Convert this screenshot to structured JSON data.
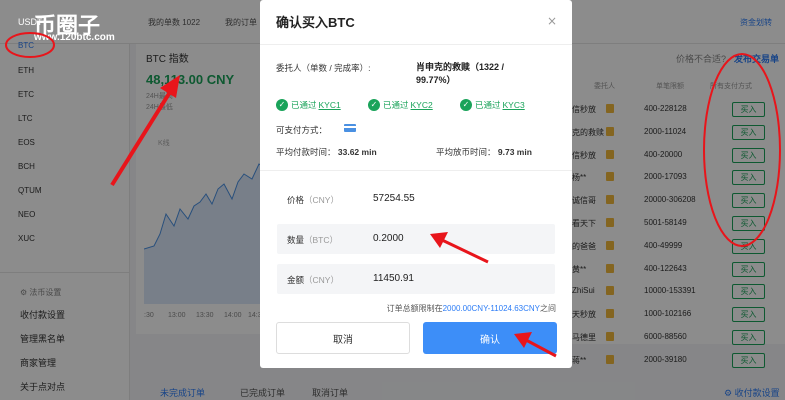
{
  "header": {
    "logo": "币圈子",
    "url": "www.120btc.com",
    "usdt": "USDT",
    "my_orders_label": "我的单数",
    "my_orders_count": "1022",
    "my_orders2": "我的订单",
    "funds_transfer": "资金划转"
  },
  "sidebar": {
    "coins": [
      "BTC",
      "ETH",
      "ETC",
      "LTC",
      "EOS",
      "BCH",
      "QTUM",
      "NEO",
      "XUC"
    ],
    "section": "法币设置",
    "items": [
      "收付款设置",
      "管理黑名单",
      "商家管理",
      "关于点对点"
    ]
  },
  "chart": {
    "title": "BTC 指数",
    "price": "48,113.00 CNY",
    "high_label": "24H最高",
    "low_label": "24H最低",
    "kline": "K线",
    "times": [
      ":30",
      "13:00",
      "13:30",
      "14:00",
      "14:30"
    ]
  },
  "market": {
    "price_prompt": "价格不合适?",
    "post_ad": "发布交易单",
    "col_user": "委托人",
    "col_limit": "单笔限额",
    "col_pay": "所有支付方式",
    "buy_label": "买入",
    "rows": [
      {
        "name": "信秒放",
        "limit": "400-228128"
      },
      {
        "name": "克的救赎",
        "limit": "2000-11024"
      },
      {
        "name": "信秒放",
        "limit": "400-20000"
      },
      {
        "name": "杨**",
        "limit": "2000-17093"
      },
      {
        "name": "诚信哥",
        "limit": "20000-306208"
      },
      {
        "name": "看天下",
        "limit": "5001-58149"
      },
      {
        "name": "的爸爸",
        "limit": "400-49999"
      },
      {
        "name": "黄**",
        "limit": "400-122643"
      },
      {
        "name": "ZhiSui",
        "limit": "10000-153391"
      },
      {
        "name": "天秒放",
        "limit": "1000-102166"
      },
      {
        "name": "马德里",
        "limit": "6000-88560"
      },
      {
        "name": "蒋**",
        "limit": "2000-39180"
      }
    ]
  },
  "bottom_tabs": [
    "未完成订单",
    "已完成订单",
    "取消订单"
  ],
  "bottom_right": "收付款设置",
  "modal": {
    "title": "确认买入BTC",
    "close": "×",
    "trustor_label": "委托人（单数 / 完成率）:",
    "trustor_value_line1": "肖申克的救赎（1322 /",
    "trustor_value_line2": "99.77%）",
    "kyc": [
      {
        "passed": "已通过",
        "level": "KYC1"
      },
      {
        "passed": "已通过",
        "level": "KYC2"
      },
      {
        "passed": "已通过",
        "level": "KYC3"
      }
    ],
    "pay_label": "可支付方式：",
    "avg_pay_label": "平均付款时间：",
    "avg_pay_value": "33.62 min",
    "avg_release_label": "平均放币时间：",
    "avg_release_value": "9.73 min",
    "price_label": "价格",
    "price_unit": "（CNY）",
    "price_value": "57254.55",
    "qty_label": "数量",
    "qty_unit": "（BTC）",
    "qty_value": "0.2000",
    "amount_label": "金额",
    "amount_unit": "（CNY）",
    "amount_value": "11450.91",
    "note_prefix": "订单总额限制在",
    "note_range": "2000.00CNY-11024.63CNY",
    "note_suffix": "之间",
    "cancel": "取消",
    "confirm": "确认"
  },
  "colors": {
    "accent": "#3d8ef8",
    "green": "#1aa35a",
    "annotation": "#e8151b"
  }
}
